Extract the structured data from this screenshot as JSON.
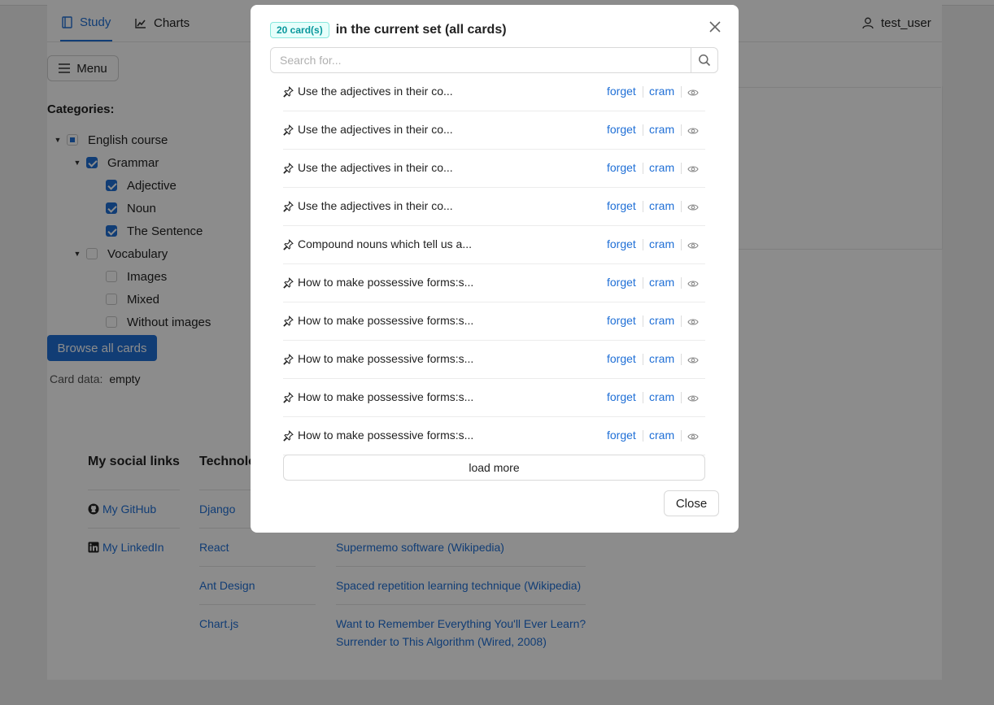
{
  "nav": {
    "study": "Study",
    "charts": "Charts",
    "user": "test_user"
  },
  "menu_label": "Menu",
  "categories": {
    "title": "Categories:",
    "items": [
      {
        "label": "English course",
        "state": "partial",
        "caret": true
      },
      {
        "label": "Grammar",
        "state": "checked",
        "caret": true
      },
      {
        "label": "Adjective",
        "state": "checked",
        "caret": false
      },
      {
        "label": "Noun",
        "state": "checked",
        "caret": false
      },
      {
        "label": "The Sentence",
        "state": "checked",
        "caret": false
      },
      {
        "label": "Vocabulary",
        "state": "unchecked",
        "caret": true
      },
      {
        "label": "Images",
        "state": "unchecked",
        "caret": false
      },
      {
        "label": "Mixed",
        "state": "unchecked",
        "caret": false
      },
      {
        "label": "Without images",
        "state": "unchecked",
        "caret": false
      }
    ]
  },
  "browse_label": "Browse all cards",
  "card_data": {
    "label": "Card data",
    "value": "empty"
  },
  "footer": {
    "social_title": "My social links",
    "tech_title": "Technolo",
    "social": [
      "My GitHub",
      "My LinkedIn"
    ],
    "tech": [
      "Django",
      "React",
      "Ant Design",
      "Chart.js"
    ],
    "refs": [
      "Supermemo software (Wikipedia)",
      "Spaced repetition learning technique (Wikipedia)",
      "Want to Remember Everything You'll Ever Learn?",
      "Surrender to This Algorithm (Wired, 2008)"
    ]
  },
  "modal": {
    "badge": "20 card(s)",
    "title": "in the current set (all cards)",
    "search_placeholder": "Search for...",
    "forget_label": "forget",
    "cram_label": "cram",
    "cards": [
      "Use the adjectives in their co...",
      "Use the adjectives in their co...",
      "Use the adjectives in their co...",
      "Use the adjectives in their co...",
      "Compound nouns which tell us a...",
      "How to make possessive forms:s...",
      "How to make possessive forms:s...",
      "How to make possessive forms:s...",
      "How to make possessive forms:s...",
      "How to make possessive forms:s..."
    ],
    "load_more": "load more",
    "close": "Close"
  },
  "colors": {
    "accent": "#1f6fd6",
    "badge_bg": "#e6fffb",
    "badge_text": "#08979c"
  }
}
